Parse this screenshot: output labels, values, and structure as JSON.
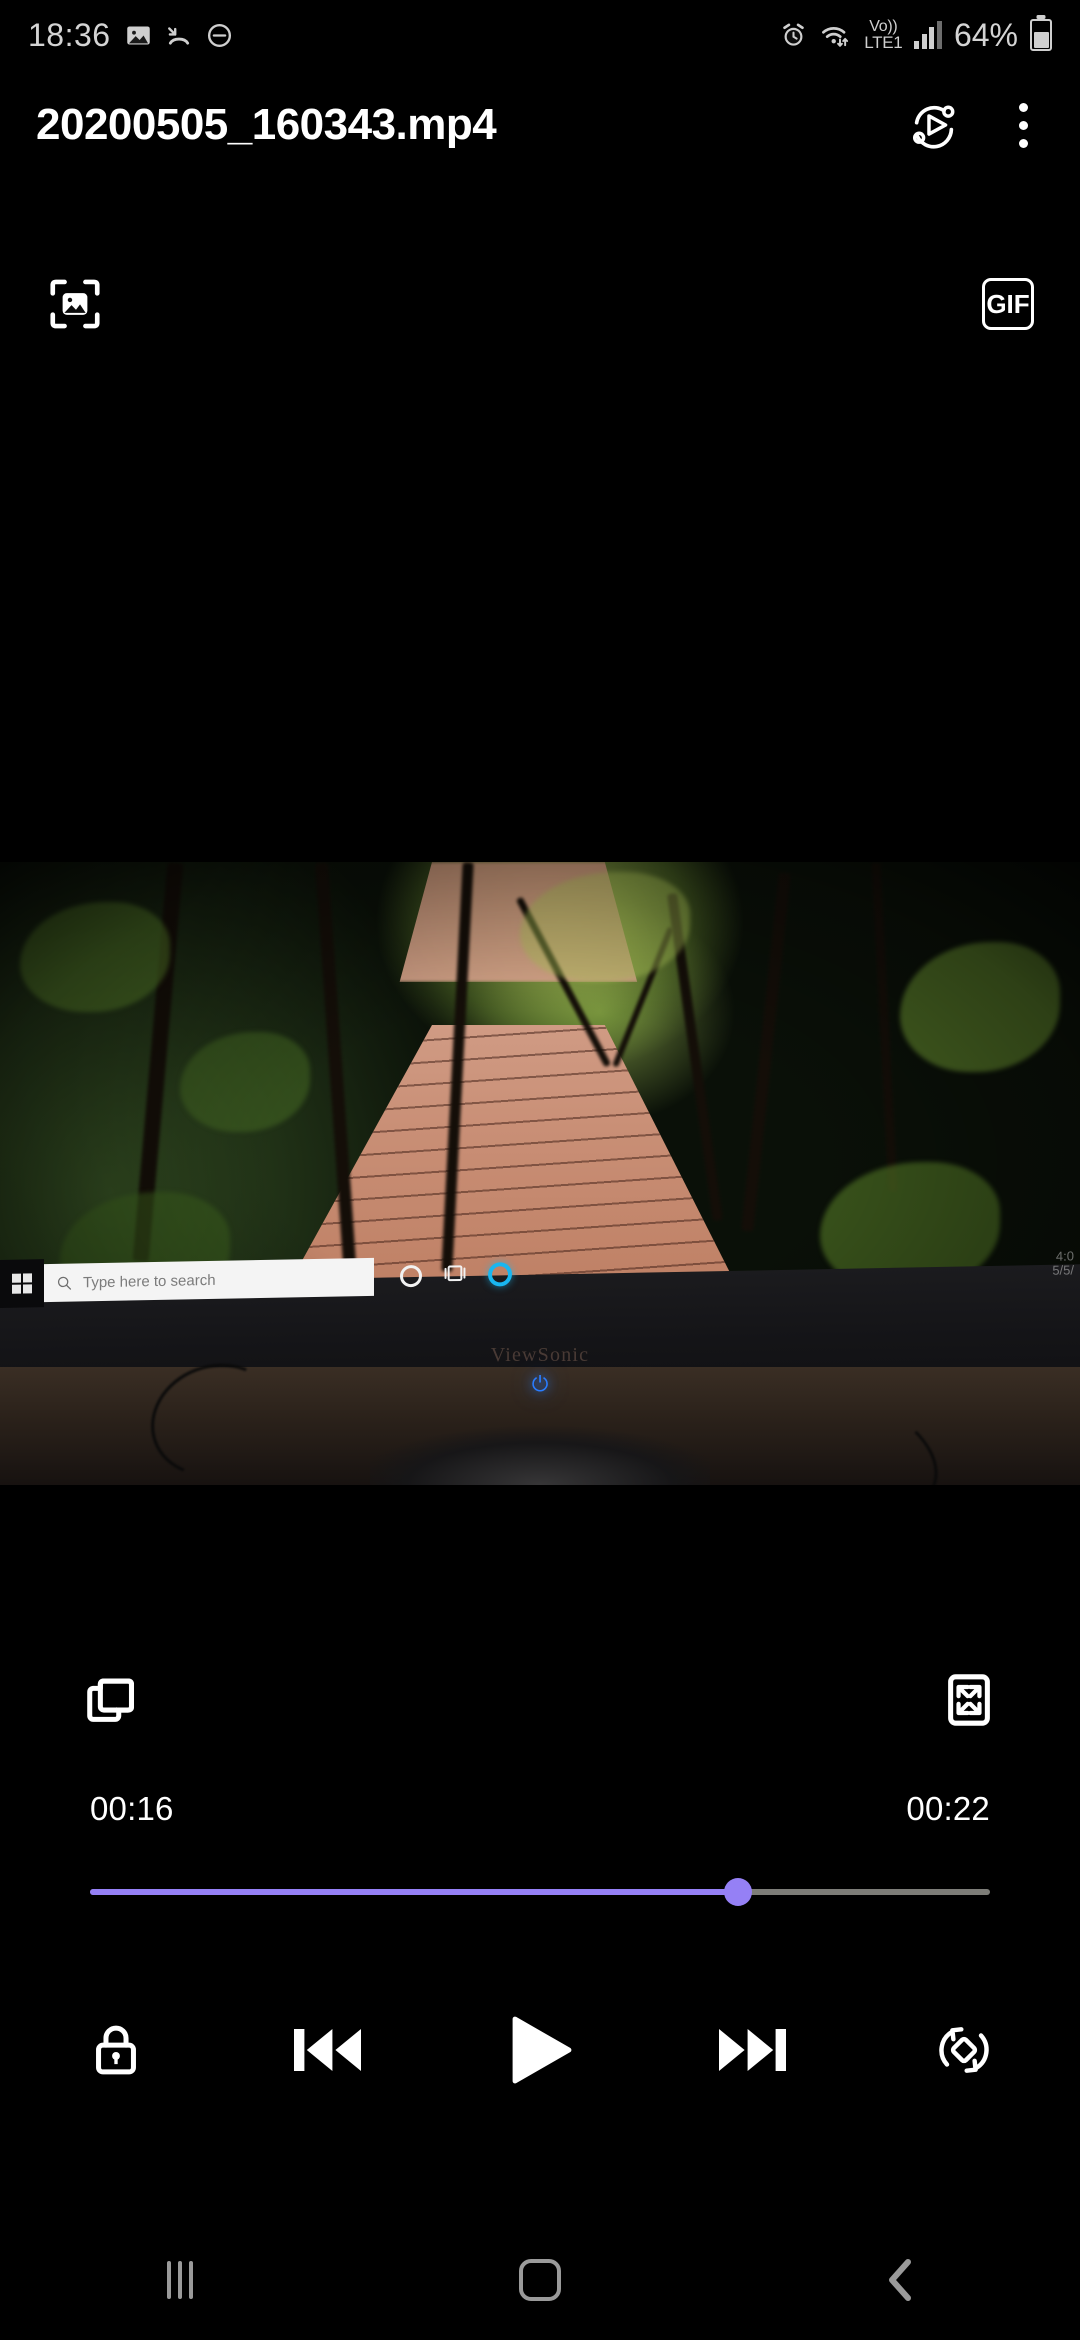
{
  "status_bar": {
    "clock": "18:36",
    "battery_percent": "64%",
    "network_top": "Vo))",
    "network_bottom": "LTE1",
    "icons": [
      "image-icon",
      "call-missed-icon",
      "do-not-disturb-icon",
      "alarm-icon",
      "wifi-icon",
      "signal-icon",
      "battery-icon"
    ]
  },
  "title_bar": {
    "file_name": "20200505_160343.mp4",
    "smart_view_icon": "smart-view-icon",
    "overflow_icon": "more-options-icon"
  },
  "sub_toolbar": {
    "smart_capture_icon": "smart-capture-icon",
    "gif_label": "GIF"
  },
  "video": {
    "scene": "forest boardwalk on a computer monitor",
    "monitor_brand": "ViewSonic",
    "taskbar": {
      "search_placeholder": "Type here to search",
      "start_icon": "windows-start-icon",
      "search_icon": "search-icon",
      "cortana_icon": "cortana-icon",
      "task_view_icon": "task-view-icon",
      "edge_icon": "edge-icon",
      "clock_line1": "4:0",
      "clock_line2": "5/5/"
    }
  },
  "controls": {
    "popup_player_label": "popup-player-icon",
    "fullscreen_label": "fullscreen-icon",
    "current_time": "00:16",
    "total_time": "00:22",
    "progress_percent": 72,
    "lock_label": "lock-icon",
    "previous_label": "previous-icon",
    "play_label": "play-icon",
    "next_label": "next-icon",
    "rotate_label": "rotate-icon"
  },
  "nav_bar": {
    "recents_label": "recents-icon",
    "home_label": "home-icon",
    "back_label": "back-icon"
  },
  "colors": {
    "accent": "#9580f5",
    "track": "#7d7d78",
    "background": "#000000",
    "status_text": "#d4d4d4",
    "nav_icon": "#9a9a9a"
  }
}
